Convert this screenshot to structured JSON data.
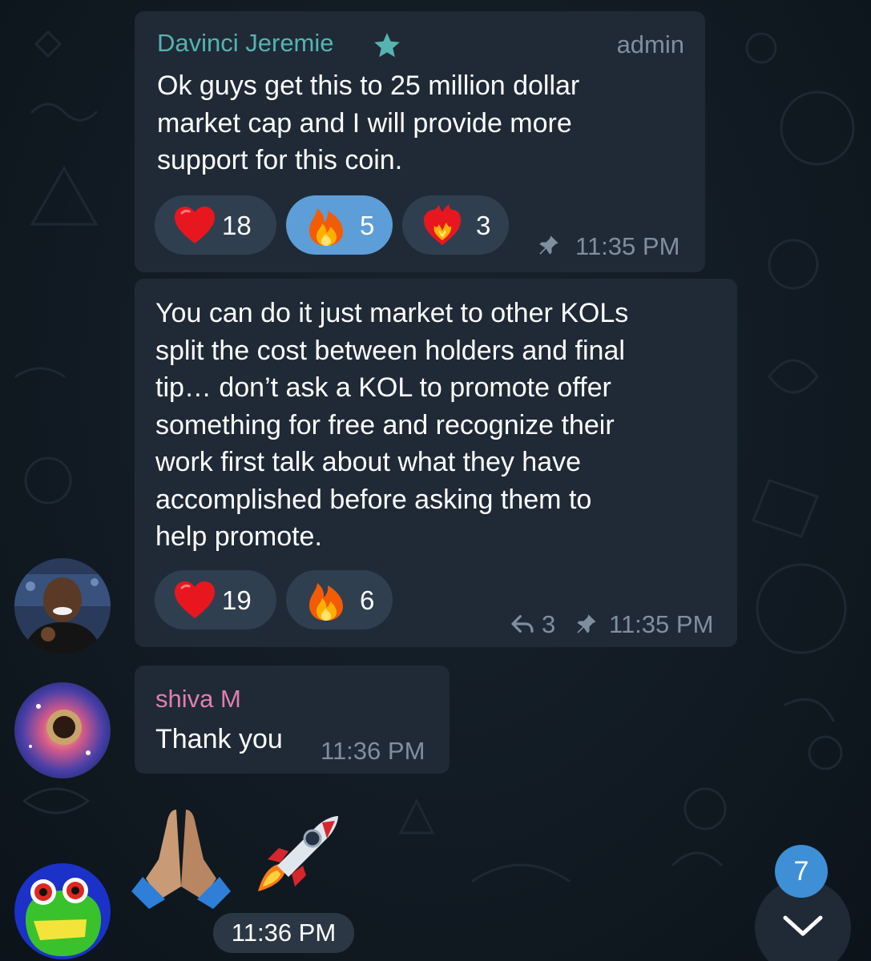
{
  "colors": {
    "background": "#111a22",
    "bubble": "#1f2a36",
    "reaction_pill": "#2f3f50",
    "reaction_pill_active": "#5d9ed8",
    "admin_name": "#56b3b0",
    "shiva_name": "#e17fae",
    "meta_text": "#7f8f9e",
    "unread_badge": "#3e8fd6"
  },
  "messages": [
    {
      "sender": "Davinci Jeremie",
      "sender_badge_icon": "star-icon",
      "role": "admin",
      "text_lines": [
        "Ok guys get this to 25 million dollar",
        "market cap and I will provide more",
        "support for this coin."
      ],
      "reactions": [
        {
          "emoji": "red-heart",
          "count": "18"
        },
        {
          "emoji": "fire",
          "count": "5"
        },
        {
          "emoji": "heart-on-fire",
          "count": "3"
        }
      ],
      "pinned_icon": "pin-icon",
      "time": "11:35 PM"
    },
    {
      "text_lines": [
        "You can do it just market to other KOLs",
        "split the cost between holders and final",
        "tip… don’t ask a KOL to promote offer",
        "something for free and recognize their",
        "work first talk about what they have",
        "accomplished before asking them to",
        "help promote."
      ],
      "reactions": [
        {
          "emoji": "red-heart",
          "count": "19"
        },
        {
          "emoji": "fire",
          "count": "6"
        }
      ],
      "reply_icon": "reply-arrow-icon",
      "replies": "3",
      "pinned_icon": "pin-icon",
      "time": "11:35 PM"
    },
    {
      "sender": "shiva M",
      "text": "Thank you",
      "time": "11:36 PM"
    },
    {
      "sticker_emojis": [
        "folded-hands",
        "rocket"
      ],
      "time": "11:36 PM"
    }
  ],
  "scroll_button": {
    "icon": "chevron-down-icon",
    "unread_count": "7"
  }
}
